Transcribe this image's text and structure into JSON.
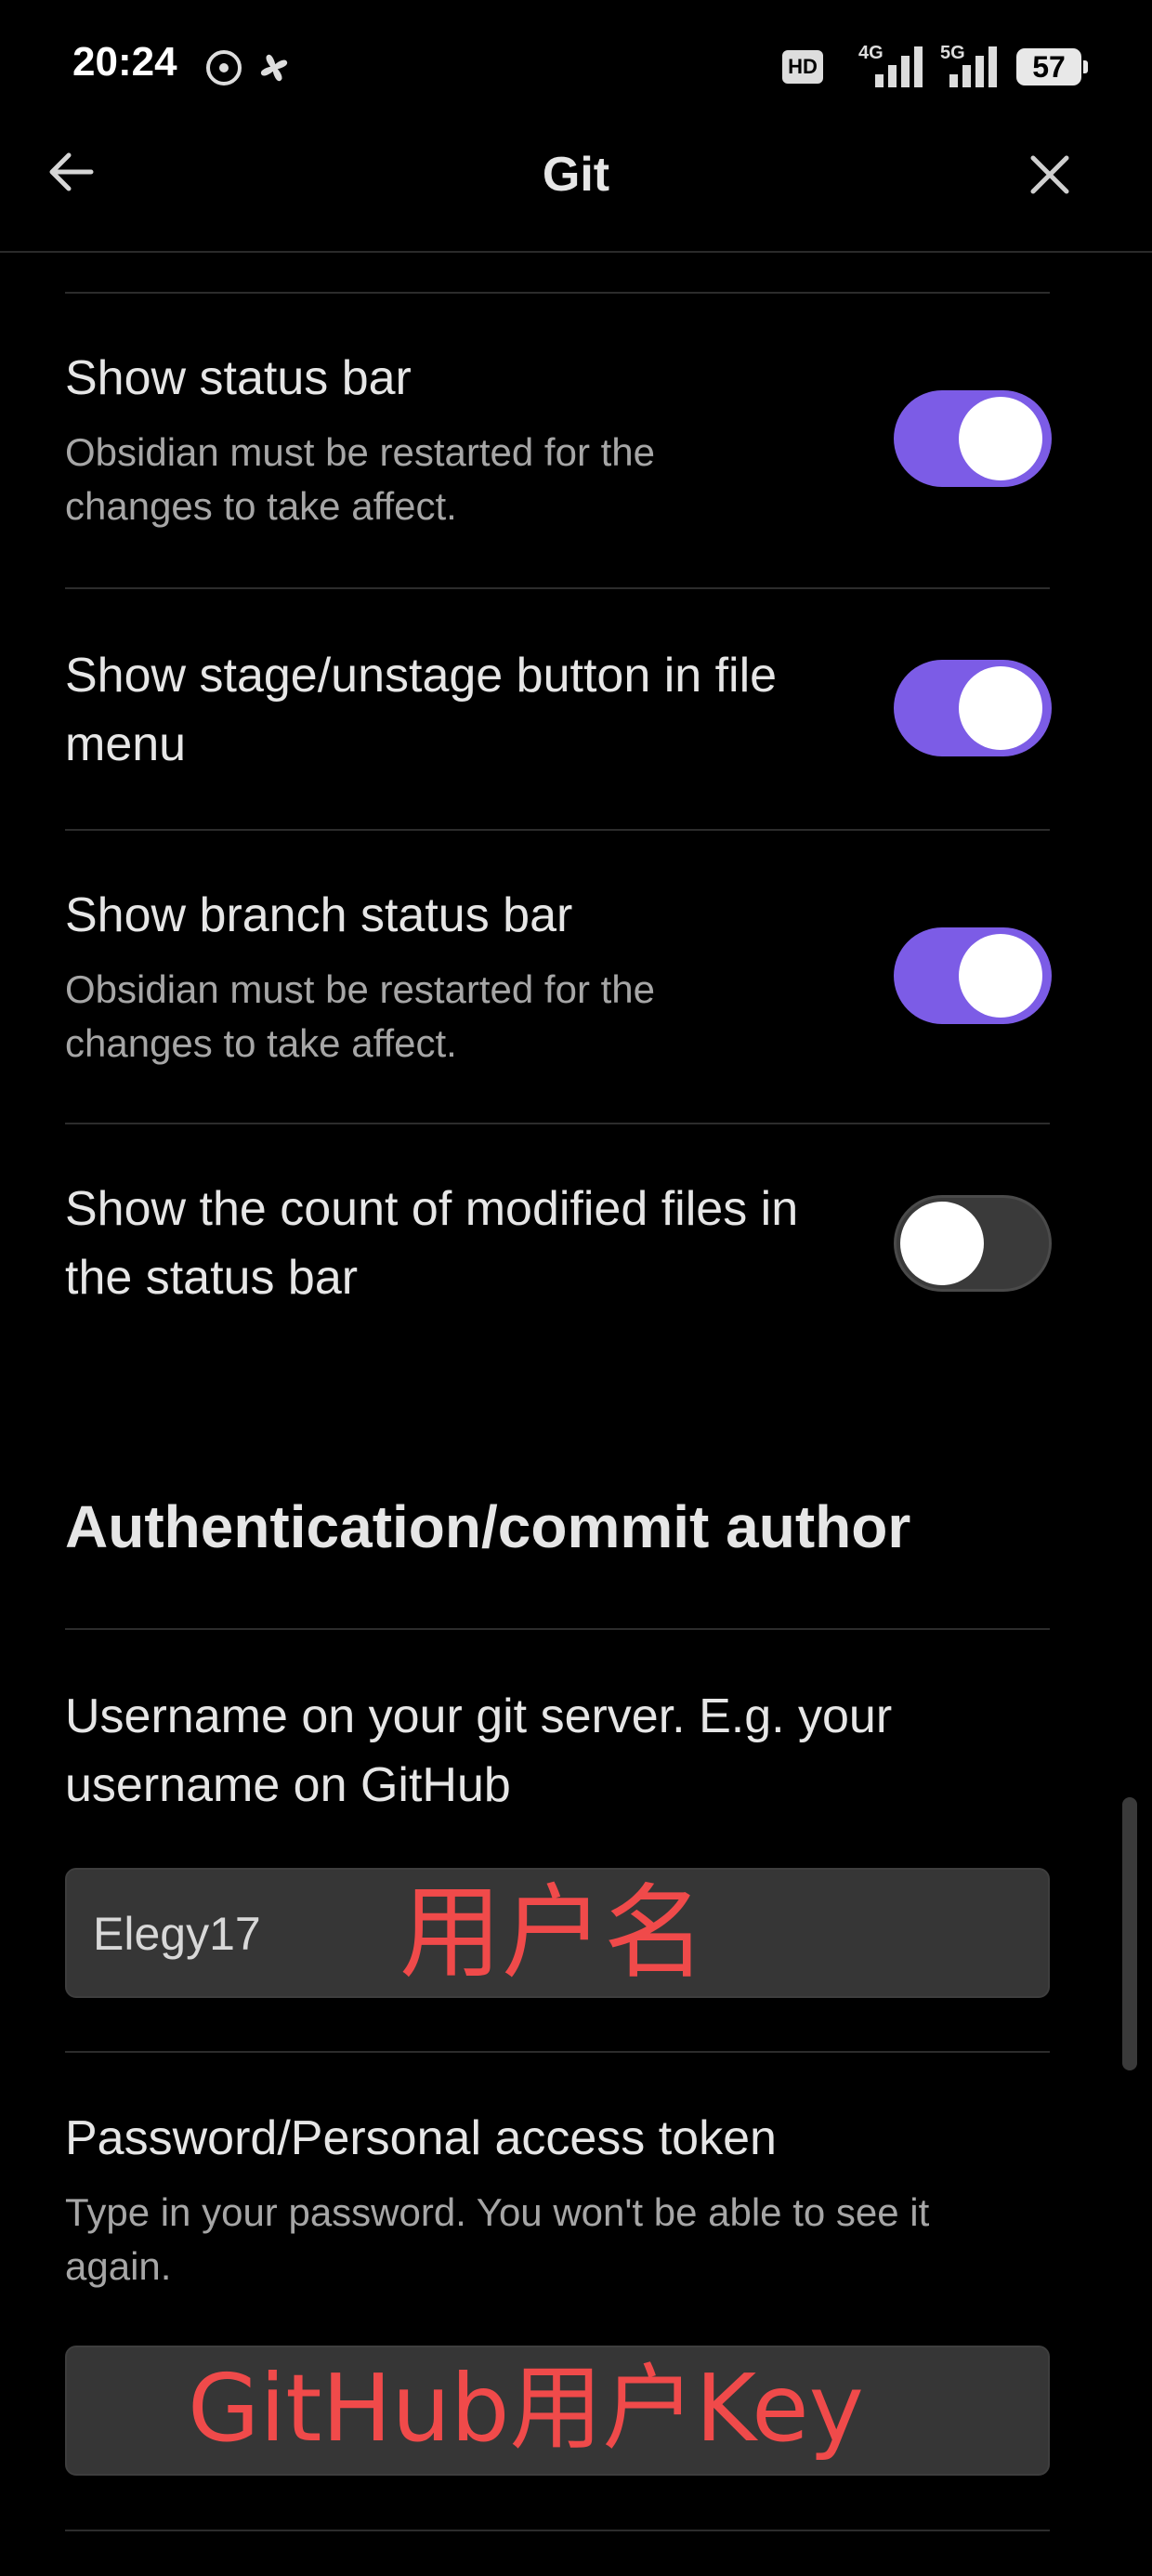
{
  "status_bar": {
    "time": "20:24",
    "battery": "57",
    "network_labels": [
      "HD",
      "4G",
      "5G"
    ]
  },
  "header": {
    "title": "Git",
    "back_icon": "arrow-left-icon",
    "close_icon": "close-icon"
  },
  "settings": [
    {
      "name": "Show status bar",
      "desc": "Obsidian must be restarted for the changes to take affect.",
      "enabled": true
    },
    {
      "name": "Show stage/unstage button in file menu",
      "desc": "",
      "enabled": true
    },
    {
      "name": "Show branch status bar",
      "desc": "Obsidian must be restarted for the changes to take affect.",
      "enabled": true
    },
    {
      "name": "Show the count of modified files in the status bar",
      "desc": "",
      "enabled": false
    }
  ],
  "auth_section": {
    "heading": "Authentication/commit author",
    "username": {
      "name": "Username on your git server. E.g. your username on GitHub",
      "value": "Elegy17",
      "annotation": "用户名"
    },
    "password": {
      "name": "Password/Personal access token",
      "desc": "Type in your password. You won't be able to see it again.",
      "value": "",
      "annotation": "GitHub用户Key"
    }
  },
  "colors": {
    "accent": "#7c5ce6",
    "background": "#000000",
    "annotation": "#f04a4a"
  }
}
